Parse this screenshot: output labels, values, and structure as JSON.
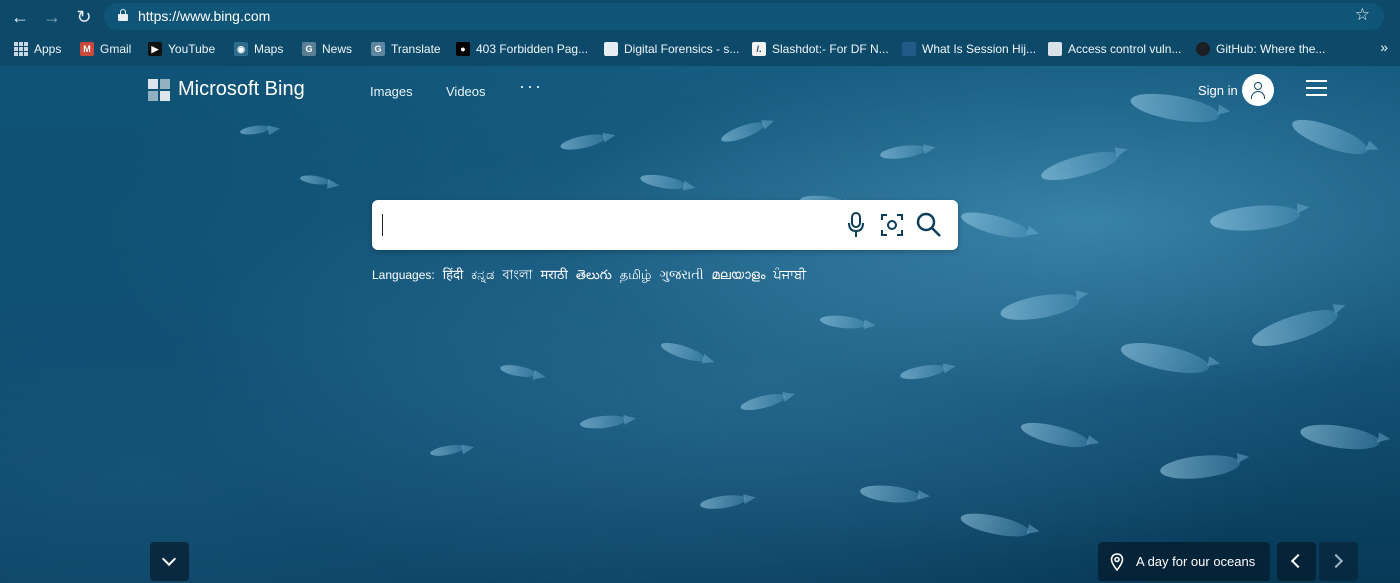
{
  "browser": {
    "url": "https://www.bing.com",
    "bookmarks": [
      {
        "label": "Apps",
        "icon": "apps-grid-icon"
      },
      {
        "label": "Gmail",
        "icon": "gmail-icon"
      },
      {
        "label": "YouTube",
        "icon": "youtube-icon"
      },
      {
        "label": "Maps",
        "icon": "maps-icon"
      },
      {
        "label": "News",
        "icon": "news-icon"
      },
      {
        "label": "Translate",
        "icon": "translate-icon"
      },
      {
        "label": "403 Forbidden Pag...",
        "icon": "medium-icon"
      },
      {
        "label": "Digital Forensics - s...",
        "icon": "page-icon"
      },
      {
        "label": "Slashdot:- For DF N...",
        "icon": "slashdot-icon"
      },
      {
        "label": "What Is Session Hij...",
        "icon": "shield-icon"
      },
      {
        "label": "Access control vuln...",
        "icon": "page-icon"
      },
      {
        "label": "GitHub: Where the...",
        "icon": "github-icon"
      }
    ],
    "more_bookmarks": "»"
  },
  "header": {
    "logo_text": "Microsoft Bing",
    "nav": {
      "images": "Images",
      "videos": "Videos",
      "more": "···"
    },
    "sign_in": "Sign in"
  },
  "search": {
    "value": "",
    "placeholder": ""
  },
  "languages": {
    "label": "Languages:",
    "items": [
      "हिंदी",
      "ಕನ್ನಡ",
      "বাংলা",
      "मराठी",
      "తెలుగు",
      "தமிழ்",
      "ગુજરાતી",
      "മലയാളം",
      "ਪੰਜਾਬੀ"
    ]
  },
  "footer": {
    "caption": "A day for our oceans"
  },
  "colors": {
    "chrome_bg": "#0d4a6a",
    "page_bg": "#0c4a6c",
    "search_bg": "#ffffff",
    "icon_dark": "#0d3f5c"
  }
}
